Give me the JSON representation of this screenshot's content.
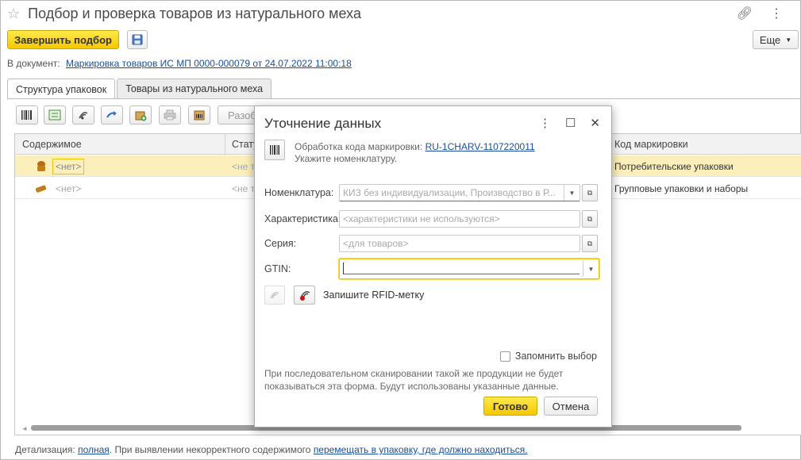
{
  "window": {
    "title": "Подбор и проверка товаров из натурального меха"
  },
  "toolbar": {
    "finish_label": "Завершить подбор",
    "more_label": "Еще",
    "partial_buttons": [
      "Разоб"
    ]
  },
  "document": {
    "prefix": "В документ:",
    "link": "Маркировка товаров ИС МП 0000-000079 от 24.07.2022 11:00:18"
  },
  "tabs": [
    {
      "label": "Структура упаковок",
      "active": true
    },
    {
      "label": "Товары из натурального меха",
      "active": false
    }
  ],
  "grid": {
    "columns": [
      "Содержимое",
      "Стату",
      "Код маркировки"
    ],
    "rows": [
      {
        "content": "<нет>",
        "status": "<не т",
        "code": "Потребительские упаковки",
        "selected": true
      },
      {
        "content": "<нет>",
        "status": "<не т",
        "code": "Групповые упаковки и наборы",
        "selected": false
      }
    ]
  },
  "footer": {
    "prefix": "Детализация:",
    "link1": "полная",
    "middle": ". При выявлении некорректного содержимого",
    "link2": "перемещать в упаковку, где должно находиться."
  },
  "dialog": {
    "title": "Уточнение данных",
    "scan_prefix": "Обработка кода маркировки:",
    "scan_code": "RU-1CHARV-1107220011",
    "scan_hint": "Укажите номенклатуру.",
    "fields": [
      {
        "label": "Номенклатура:",
        "placeholder": "КИЗ без индивидуализации, Производство в Р..."
      },
      {
        "label": "Характеристика:",
        "placeholder": "<характеристики не используются>"
      },
      {
        "label": "Серия:",
        "placeholder": "<для товаров>"
      },
      {
        "label": "GTIN:",
        "value": ""
      }
    ],
    "rfid_label": "Запишите RFID-метку",
    "remember_label": "Запомнить выбор",
    "remember_checked": false,
    "note": "При последовательном сканировании такой же продукции не будет показываться эта форма. Будут использованы указанные данные.",
    "ok_label": "Готово",
    "cancel_label": "Отмена"
  },
  "colors": {
    "accent_yellow": "#f5c800",
    "link": "#1a4fa0",
    "selected_row": "#fbefbb",
    "error_underline": "#d04040"
  }
}
